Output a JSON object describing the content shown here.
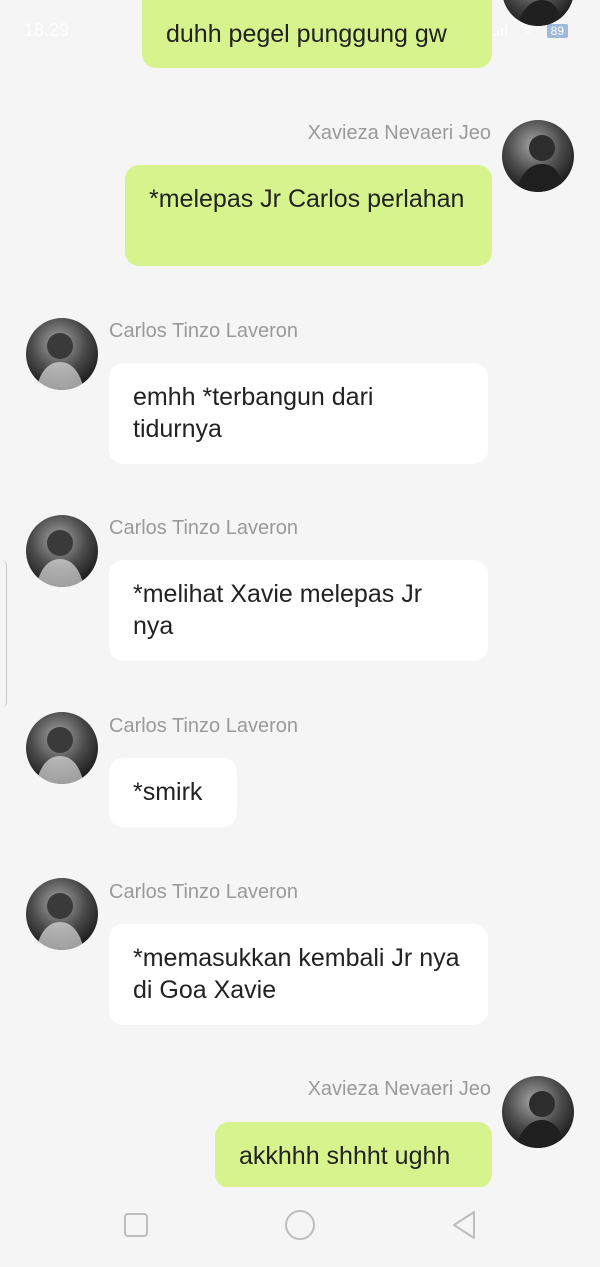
{
  "status_bar": {
    "time": "18.29",
    "battery": "89"
  },
  "messages": [
    {
      "side": "right",
      "sender": "",
      "text": "duhh pegel punggung gw"
    },
    {
      "side": "right",
      "sender": "Xavieza Nevaeri Jeo",
      "text": "*melepas Jr Carlos perlahan"
    },
    {
      "side": "left",
      "sender": "Carlos Tinzo Laveron",
      "text": "emhh *terbangun dari tidurnya"
    },
    {
      "side": "left",
      "sender": "Carlos Tinzo Laveron",
      "text": "*melihat Xavie melepas Jr nya"
    },
    {
      "side": "left",
      "sender": "Carlos Tinzo Laveron",
      "text": "*smirk"
    },
    {
      "side": "left",
      "sender": "Carlos Tinzo Laveron",
      "text": "*memasukkan kembali Jr nya di Goa Xavie"
    },
    {
      "side": "right",
      "sender": "Xavieza Nevaeri Jeo",
      "text": "akkhhh shhht ughh"
    }
  ],
  "navigation": {
    "recent": "square-icon",
    "home": "circle-icon",
    "back": "triangle-back-icon"
  }
}
